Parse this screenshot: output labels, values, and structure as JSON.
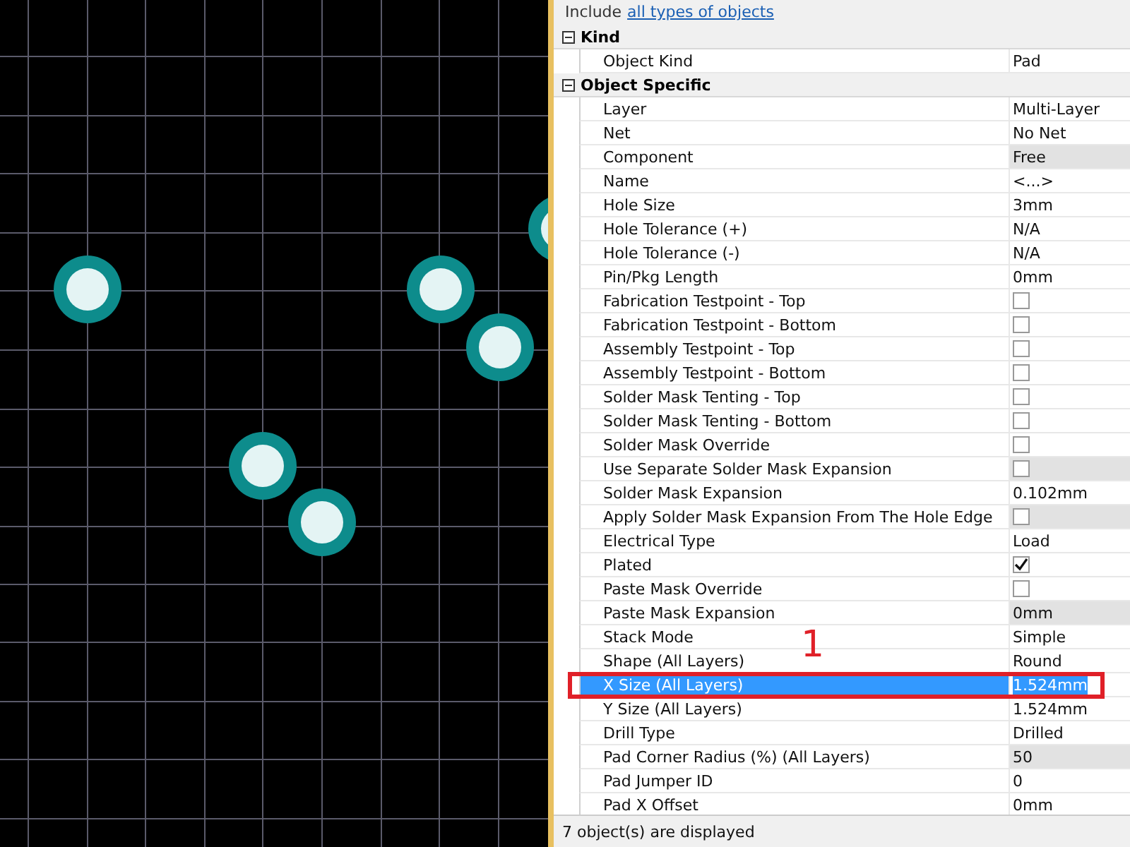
{
  "filter": {
    "label": "Include",
    "link": "all types of objects"
  },
  "groups": [
    {
      "title": "Kind",
      "expanded": true,
      "rows": [
        {
          "name": "Object Kind",
          "kind": "text",
          "value": "Pad",
          "readonly": false,
          "selected": false
        }
      ]
    },
    {
      "title": "Object Specific",
      "expanded": true,
      "rows": [
        {
          "name": "Layer",
          "kind": "text",
          "value": "Multi-Layer",
          "readonly": false,
          "selected": false
        },
        {
          "name": "Net",
          "kind": "text",
          "value": "No Net",
          "readonly": false,
          "selected": false
        },
        {
          "name": "Component",
          "kind": "text",
          "value": "Free",
          "readonly": true,
          "selected": false
        },
        {
          "name": "Name",
          "kind": "text",
          "value": "<...>",
          "readonly": false,
          "selected": false
        },
        {
          "name": "Hole Size",
          "kind": "text",
          "value": "3mm",
          "readonly": false,
          "selected": false
        },
        {
          "name": "Hole Tolerance (+)",
          "kind": "text",
          "value": "N/A",
          "readonly": false,
          "selected": false
        },
        {
          "name": "Hole Tolerance (-)",
          "kind": "text",
          "value": "N/A",
          "readonly": false,
          "selected": false
        },
        {
          "name": "Pin/Pkg Length",
          "kind": "text",
          "value": "0mm",
          "readonly": false,
          "selected": false
        },
        {
          "name": "Fabrication Testpoint - Top",
          "kind": "checkbox",
          "checked": false,
          "readonly": false,
          "selected": false
        },
        {
          "name": "Fabrication Testpoint - Bottom",
          "kind": "checkbox",
          "checked": false,
          "readonly": false,
          "selected": false
        },
        {
          "name": "Assembly Testpoint - Top",
          "kind": "checkbox",
          "checked": false,
          "readonly": false,
          "selected": false
        },
        {
          "name": "Assembly Testpoint - Bottom",
          "kind": "checkbox",
          "checked": false,
          "readonly": false,
          "selected": false
        },
        {
          "name": "Solder Mask Tenting - Top",
          "kind": "checkbox",
          "checked": false,
          "readonly": false,
          "selected": false
        },
        {
          "name": "Solder Mask Tenting - Bottom",
          "kind": "checkbox",
          "checked": false,
          "readonly": false,
          "selected": false
        },
        {
          "name": "Solder Mask Override",
          "kind": "checkbox",
          "checked": false,
          "readonly": false,
          "selected": false
        },
        {
          "name": "Use Separate Solder Mask Expansion",
          "kind": "checkbox",
          "checked": false,
          "readonly": true,
          "selected": false
        },
        {
          "name": "Solder Mask Expansion",
          "kind": "text",
          "value": "0.102mm",
          "readonly": false,
          "selected": false
        },
        {
          "name": "Apply Solder Mask Expansion From The Hole Edge",
          "kind": "checkbox",
          "checked": false,
          "readonly": true,
          "selected": false
        },
        {
          "name": "Electrical Type",
          "kind": "text",
          "value": "Load",
          "readonly": false,
          "selected": false
        },
        {
          "name": "Plated",
          "kind": "checkbox",
          "checked": true,
          "readonly": false,
          "selected": false
        },
        {
          "name": "Paste Mask Override",
          "kind": "checkbox",
          "checked": false,
          "readonly": false,
          "selected": false
        },
        {
          "name": "Paste Mask Expansion",
          "kind": "text",
          "value": "0mm",
          "readonly": true,
          "selected": false
        },
        {
          "name": "Stack Mode",
          "kind": "text",
          "value": "Simple",
          "readonly": false,
          "selected": false
        },
        {
          "name": "Shape (All Layers)",
          "kind": "text",
          "value": "Round",
          "readonly": false,
          "selected": false
        },
        {
          "name": "X Size (All Layers)",
          "kind": "text",
          "value": "1.524mm",
          "readonly": false,
          "selected": true
        },
        {
          "name": "Y Size (All Layers)",
          "kind": "text",
          "value": "1.524mm",
          "readonly": false,
          "selected": false
        },
        {
          "name": "Drill Type",
          "kind": "text",
          "value": "Drilled",
          "readonly": false,
          "selected": false
        },
        {
          "name": "Pad Corner Radius (%) (All Layers)",
          "kind": "text",
          "value": "50",
          "readonly": true,
          "selected": false
        },
        {
          "name": "Pad Jumper ID",
          "kind": "text",
          "value": "0",
          "readonly": false,
          "selected": false
        },
        {
          "name": "Pad X Offset",
          "kind": "text",
          "value": "0mm",
          "readonly": false,
          "selected": false
        }
      ]
    }
  ],
  "annotation": {
    "label": "1"
  },
  "status_bar": "7 object(s) are displayed"
}
